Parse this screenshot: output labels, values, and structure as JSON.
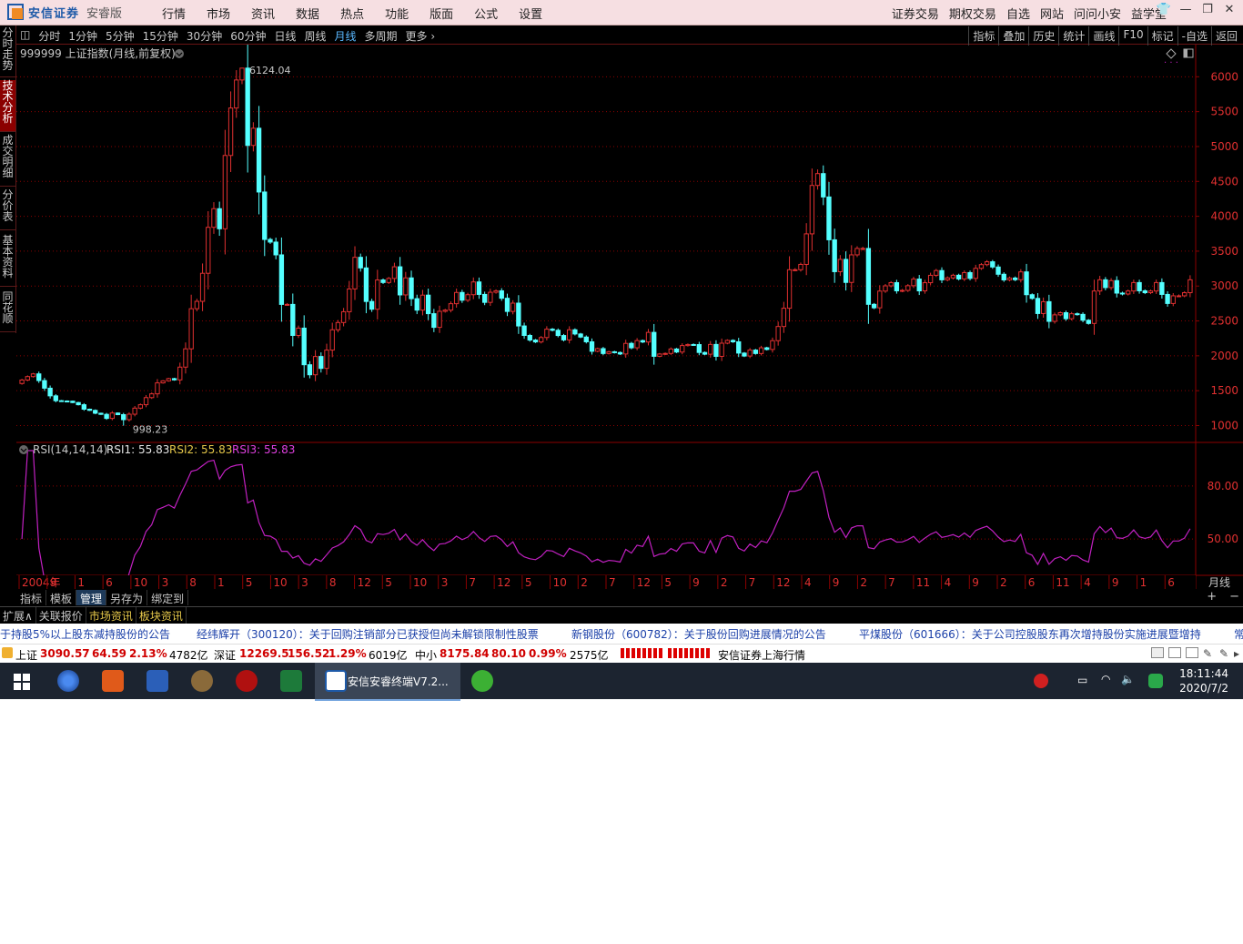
{
  "app": {
    "brand": "安信证券",
    "edition": "安睿版",
    "main_menu": [
      "行情",
      "市场",
      "资讯",
      "数据",
      "热点",
      "功能",
      "版面",
      "公式",
      "设置"
    ],
    "right_menu": [
      "证券交易",
      "期权交易",
      "自选",
      "网站",
      "问问小安",
      "益学堂"
    ],
    "window_controls": [
      "shirt-icon",
      "minimize-icon",
      "restore-icon",
      "close-icon"
    ]
  },
  "left_tabs": [
    {
      "label": "分时走势",
      "active": false
    },
    {
      "label": "技术分析",
      "active": true
    },
    {
      "label": "成交明细",
      "active": false
    },
    {
      "label": "分价表",
      "active": false
    },
    {
      "label": "基本资料",
      "active": false
    },
    {
      "label": "同花顺",
      "active": false
    }
  ],
  "period_bar": {
    "periods": [
      "分时",
      "1分钟",
      "5分钟",
      "15分钟",
      "30分钟",
      "60分钟",
      "日线",
      "周线",
      "月线",
      "多周期",
      "更多 ›"
    ],
    "active": "月线",
    "right_items": [
      "指标",
      "叠加",
      "历史",
      "统计",
      "画线",
      "F10",
      "标记",
      "-自选",
      "返回"
    ]
  },
  "chart_header": {
    "title": "999999 上证指数(月线,前复权)",
    "high_label": "6124.04",
    "low_label": "998.23"
  },
  "rsi_header": {
    "name": "RSI(14,14,14)",
    "rsi1": "RSI1: 55.83",
    "rsi2": "RSI2: 55.83",
    "rsi3": "RSI3: 55.83"
  },
  "period_indicator": "月线",
  "bottom_tabs": [
    "指标",
    "模板",
    "管理",
    "另存为",
    "绑定到"
  ],
  "bottom_tabs_active": "管理",
  "bottom_right": [
    "+",
    "−"
  ],
  "info_tabs": [
    "扩展∧",
    "关联报价",
    "市场资讯",
    "板块资讯"
  ],
  "news": [
    "于持股5%以上股东减持股份的公告",
    "经纬辉开（300120）：关于回购注销部分已获授但尚未解锁限制性股票",
    "新钢股份（600782）：关于股份回购进展情况的公告",
    "平煤股份（601666）：关于公司控股股东再次增持股份实施进展暨增持",
    "常"
  ],
  "status": {
    "sh_name": "上证",
    "sh_value": "3090.57",
    "sh_change": "64.59",
    "sh_pct": "2.13%",
    "sh_amount": "4782亿",
    "sz_name": "深证",
    "sz_value": "12269.5",
    "sz_change": "156.52",
    "sz_pct": "1.29%",
    "sz_amount": "6019亿",
    "zx_name": "中小",
    "zx_value": "8175.84",
    "zx_change": "80.10",
    "zx_pct": "0.99%",
    "zx_amount": "2575亿",
    "feed": "安信证券上海行情"
  },
  "taskbar": {
    "active_window": "安信安睿终端V7.2...",
    "time": "18:11:44",
    "date": "2020/7/2"
  },
  "colors": {
    "up": "#e03030",
    "down": "#54ffff",
    "rsi": "#c020c0",
    "grid": "#8b0000",
    "background": "#000000"
  },
  "chart_data": {
    "type": "candlestick",
    "title": "999999 上证指数(月线,前复权)",
    "y_ticks": [
      1000,
      1500,
      2000,
      2500,
      3000,
      3500,
      4000,
      4500,
      5000,
      5500,
      6000
    ],
    "ylim": [
      850,
      6200
    ],
    "max_point": {
      "value": 6124.04
    },
    "min_point": {
      "value": 998.23
    },
    "x_labels": [
      "2004年",
      "9",
      "1",
      "6",
      "10",
      "3",
      "8",
      "1",
      "5",
      "10",
      "3",
      "8",
      "12",
      "5",
      "10",
      "3",
      "7",
      "12",
      "5",
      "10",
      "2",
      "7",
      "12",
      "5",
      "9",
      "2",
      "7",
      "12",
      "4",
      "9",
      "2",
      "7",
      "11",
      "4",
      "9",
      "2",
      "6",
      "11",
      "4",
      "9",
      "1",
      "6"
    ],
    "close": [
      1653,
      1702,
      1741,
      1645,
      1536,
      1426,
      1357,
      1352,
      1350,
      1330,
      1299,
      1235,
      1218,
      1177,
      1161,
      1103,
      1180,
      1157,
      1085,
      1163,
      1250,
      1299,
      1401,
      1455,
      1612,
      1641,
      1673,
      1655,
      1838,
      2100,
      2675,
      2781,
      3183,
      3842,
      4109,
      3821,
      4872,
      5552,
      5954,
      6124,
      5016,
      5262,
      4348,
      3668,
      3630,
      3447,
      2737,
      2737,
      2292,
      2397,
      1872,
      1728,
      1990,
      1820,
      2082,
      2373,
      2477,
      2632,
      2959,
      3412,
      3260,
      2779,
      2668,
      3087,
      3051,
      3109,
      3276,
      2873,
      3117,
      2819,
      2655,
      2870,
      2604,
      2408,
      2638,
      2655,
      2747,
      2908,
      2797,
      2876,
      3059,
      2880,
      2766,
      2911,
      2932,
      2825,
      2636,
      2755,
      2428,
      2292,
      2226,
      2199,
      2262,
      2382,
      2366,
      2291,
      2228,
      2373,
      2313,
      2269,
      2201,
      2065,
      2103,
      2033,
      2058,
      2047,
      2026,
      2178,
      2115,
      2218,
      2198,
      2336,
      1993,
      2026,
      2034,
      2098,
      2054,
      2147,
      2162,
      2161,
      2048,
      2023,
      2163,
      1992,
      2181,
      2221,
      2201,
      2039,
      1997,
      2082,
      2033,
      2115,
      2091,
      2217,
      2420,
      2682,
      3234,
      3234,
      3310,
      3748,
      4442,
      4612,
      4277,
      3663,
      3206,
      3382,
      3052,
      3447,
      3539,
      3539,
      2738,
      2688,
      2928,
      3003,
      3049,
      2932,
      2938,
      3005,
      3100,
      2931,
      3048,
      3154,
      3222,
      3089,
      3117,
      3155,
      3102,
      3193,
      3110,
      3254,
      3307,
      3348,
      3273,
      3169,
      3088,
      3115,
      3091,
      3203,
      2876,
      2823,
      2606,
      2776,
      2494,
      2587,
      2618,
      2532,
      2603,
      2594,
      2510,
      2464,
      2929,
      3090,
      2978,
      3078,
      2899,
      2886,
      2929,
      3050,
      2932,
      2905,
      2929,
      3050,
      2880,
      2750,
      2860,
      2860,
      2905,
      3090
    ]
  },
  "rsi_chart": {
    "type": "line",
    "ylim": [
      30,
      100
    ],
    "y_ticks": [
      50,
      80
    ],
    "rsi1_last": 55.83
  }
}
